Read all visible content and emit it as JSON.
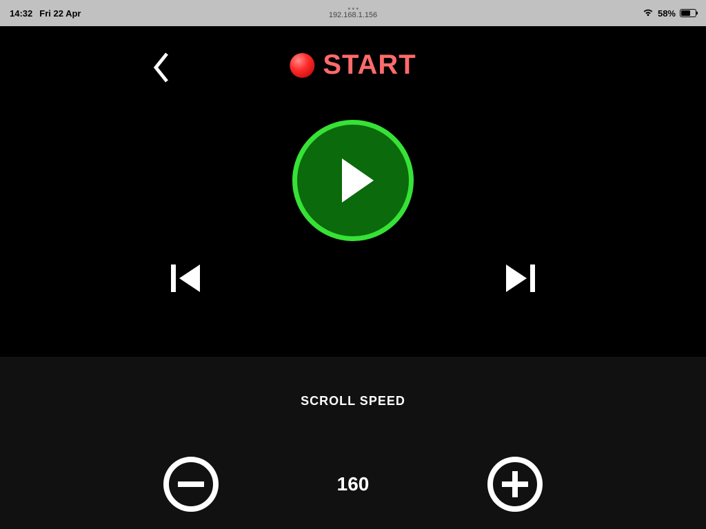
{
  "status_bar": {
    "time": "14:32",
    "date": "Fri 22 Apr",
    "ip_address": "192.168.1.156",
    "battery_text": "58%",
    "wifi_icon": "wifi"
  },
  "header": {
    "start_label": "START",
    "record_icon": "record-dot"
  },
  "controls": {
    "back_icon": "chevron-left",
    "play_icon": "play",
    "skip_prev_icon": "skip-previous",
    "skip_next_icon": "skip-next"
  },
  "speed": {
    "label": "SCROLL SPEED",
    "value": "160",
    "minus_icon": "minus",
    "plus_icon": "plus"
  }
}
